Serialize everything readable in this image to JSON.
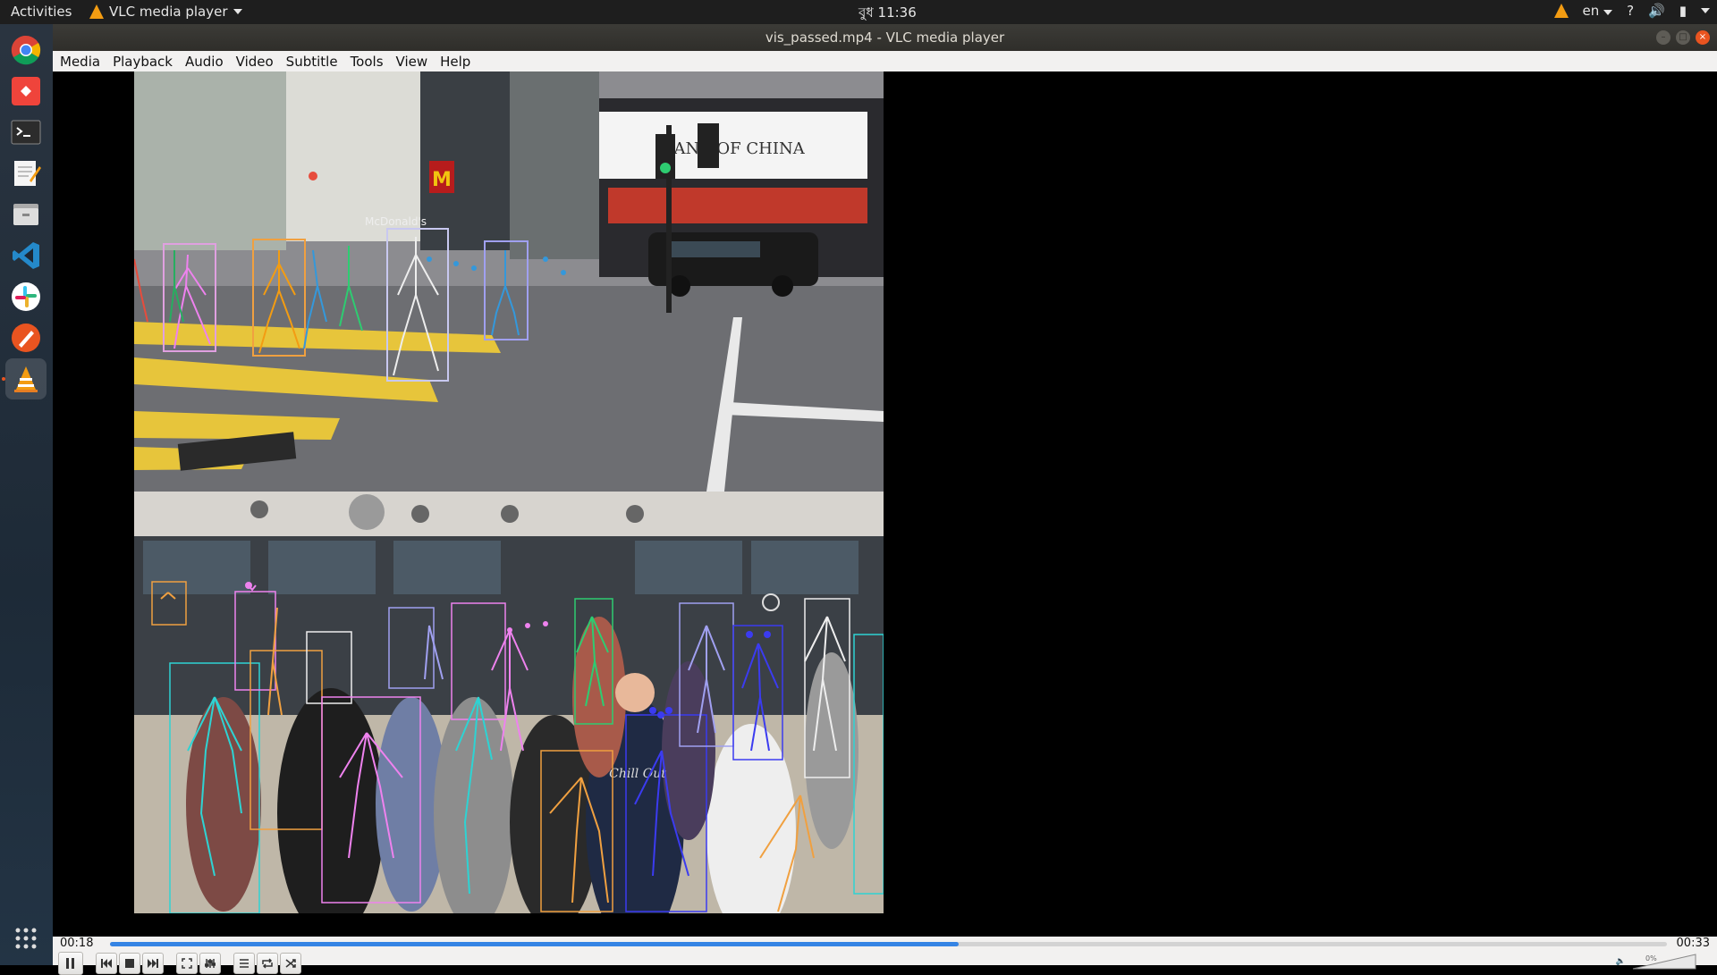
{
  "topbar": {
    "activities": "Activities",
    "app_name": "VLC media player",
    "clock": "বুধ 11:36",
    "lang": "en",
    "help": "?"
  },
  "dock": {
    "items": [
      "chrome-icon",
      "anydesk-icon",
      "terminal-icon",
      "text-editor-icon",
      "files-icon",
      "vscode-icon",
      "slack-icon",
      "inkscape-icon",
      "vlc-icon"
    ],
    "apps_grid": "show-applications-icon"
  },
  "window": {
    "title": "vis_passed.mp4 - VLC media player",
    "menus": [
      "Media",
      "Playback",
      "Audio",
      "Video",
      "Subtitle",
      "Tools",
      "View",
      "Help"
    ]
  },
  "scene_text": {
    "bank": "BANK OF CHINA",
    "store": "McDonald's",
    "shirt": "Chill Out"
  },
  "player": {
    "current_time": "00:18",
    "total_time": "00:33",
    "progress": 0.545,
    "volume_label": "0%"
  },
  "colors": {
    "accent": "#3584e4",
    "ubuntu_orange": "#e95420"
  }
}
